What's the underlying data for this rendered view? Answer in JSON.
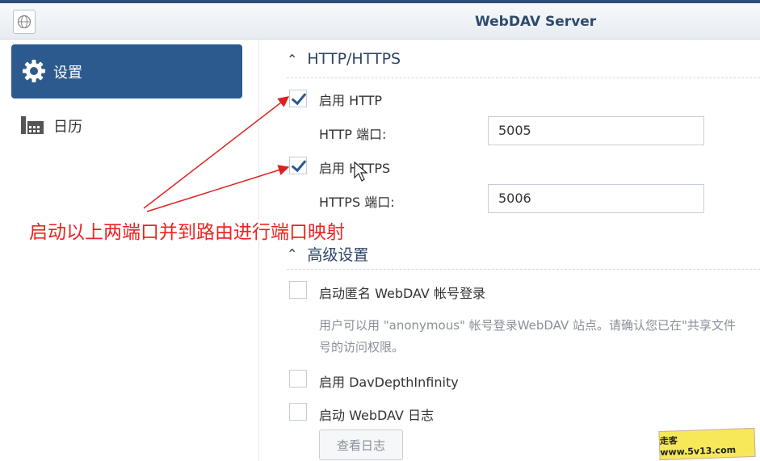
{
  "window": {
    "title": "WebDAV Server"
  },
  "sidebar": {
    "items": [
      {
        "label": "设置",
        "icon": "gear-icon"
      },
      {
        "label": "日历",
        "icon": "calendar-icon"
      }
    ]
  },
  "http_section": {
    "title": "HTTP/HTTPS",
    "enable_http": {
      "label": "启用 HTTP",
      "checked": true
    },
    "http_port": {
      "label": "HTTP 端口:",
      "value": "5005"
    },
    "enable_https": {
      "label": "启用 HTTPS",
      "checked": true
    },
    "https_port": {
      "label": "HTTPS 端口:",
      "value": "5006"
    }
  },
  "advanced_section": {
    "title": "高级设置",
    "anonymous": {
      "label": "启动匿名 WebDAV 帐号登录",
      "checked": false
    },
    "anonymous_hint_line1": "用户可以用 \"anonymous\" 帐号登录WebDAV 站点。请确认您已在\"共享文件",
    "anonymous_hint_line2": "号的访问权限。",
    "depth_infinity": {
      "label": "启用 DavDepthInfinity",
      "checked": false
    },
    "log": {
      "label": "启动 WebDAV 日志",
      "checked": false
    },
    "view_log_button": "查看日志"
  },
  "annotation": {
    "text": "启动以上两端口并到路由进行端口映射",
    "color": "#ee2222"
  },
  "watermark": {
    "text": "走客 www.5v13.com"
  },
  "colors": {
    "accent": "#2c5a8f",
    "title": "#2e4a6c"
  }
}
